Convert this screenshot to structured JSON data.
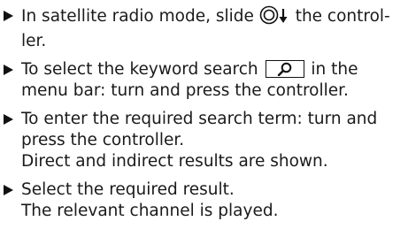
{
  "steps": [
    {
      "before": "In satellite radio mode, slide",
      "icon": "controller-slide-down-icon",
      "after": "the control-",
      "cont": "ler."
    },
    {
      "before": "To select the keyword search",
      "icon": "search-icon",
      "after": "in the",
      "cont": "menu bar: turn and press the controller."
    },
    {
      "line1": "To enter the required search term: turn and",
      "line2": "press the controller.",
      "line3": "Direct and indirect results are shown."
    },
    {
      "line1": "Select the required result.",
      "line2": "The relevant channel is played."
    }
  ]
}
